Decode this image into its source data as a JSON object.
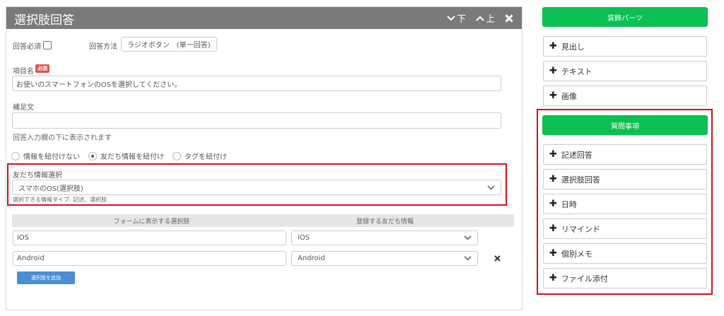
{
  "panel": {
    "title": "選択肢回答",
    "move_down": "下",
    "move_up": "上"
  },
  "form": {
    "required_label": "回答必須",
    "answer_method_label": "回答方法",
    "answer_method_value": "ラジオボタン　(単一回答)",
    "item_name_label": "項目名",
    "required_badge": "必須",
    "item_name_value": "お使いのスマートフォンのOSを選択してください。",
    "supplement_label": "補足文",
    "supplement_value": "",
    "supplement_hint": "回答入力欄の下に表示されます",
    "link_options": [
      {
        "label": "情報を紐付けない",
        "checked": false
      },
      {
        "label": "友だち情報を紐付け",
        "checked": true
      },
      {
        "label": "タグを紐付け",
        "checked": false
      }
    ],
    "friend_info_label": "友だち情報選択",
    "friend_info_value": "スマホのOS(選択肢)",
    "friend_info_hint": "選択できる情報タイプ: 記述、選択肢"
  },
  "table": {
    "col_form": "フォームに表示する選択肢",
    "col_friend": "登録する友だち情報",
    "rows": [
      {
        "choice": "iOS",
        "friend_value": "iOS",
        "deletable": false
      },
      {
        "choice": "Android",
        "friend_value": "Android",
        "deletable": true
      }
    ],
    "add_label": "選択肢を追加"
  },
  "sidebar": {
    "decor_header": "装飾パーツ",
    "decor_items": [
      "見出し",
      "テキスト",
      "画像"
    ],
    "question_header": "質問事項",
    "question_items": [
      "記述回答",
      "選択肢回答",
      "日時",
      "リマインド",
      "個別メモ",
      "ファイル添付"
    ]
  },
  "colors": {
    "header_gray": "#7a7a7a",
    "green": "#0bbf52",
    "highlight_red": "#d0111b",
    "add_blue": "#4a8fd4",
    "badge_red": "#d9534f"
  }
}
